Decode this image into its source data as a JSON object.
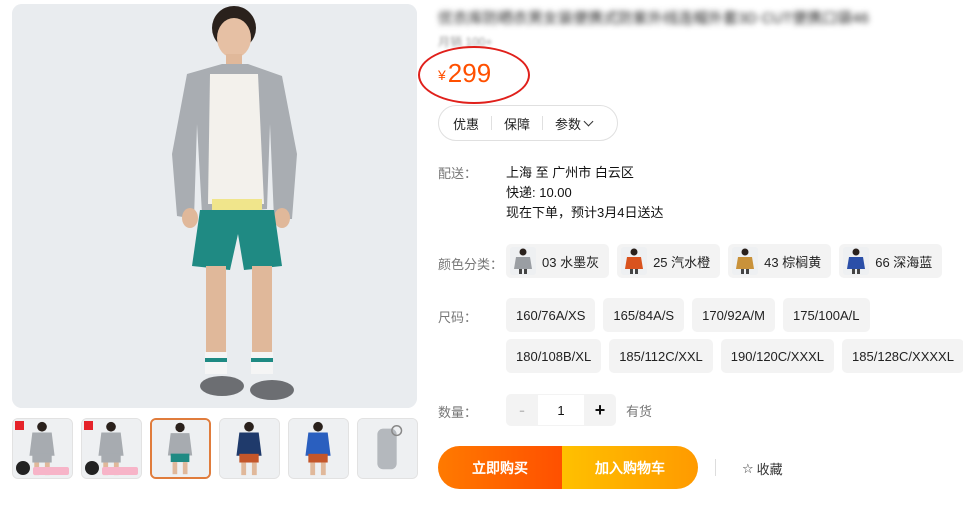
{
  "product": {
    "title": "优衣库防晒衣男女装便携式防紫外线连帽外套3D CUT便携口袋46",
    "sales": "月销 100+",
    "currency": "¥",
    "price": "299"
  },
  "tabs": [
    "优惠",
    "保障",
    "参数"
  ],
  "shipping": {
    "label": "配送：",
    "route": "上海 至 广州市 白云区",
    "express": "快递: 10.00",
    "eta": "现在下单，预计3月4日送达"
  },
  "colors": {
    "label": "颜色分类：",
    "options": [
      {
        "name": "03 水墨灰",
        "color": "#9a9ea3"
      },
      {
        "name": "25 汽水橙",
        "color": "#d9531e"
      },
      {
        "name": "43 棕榈黄",
        "color": "#c9923a"
      },
      {
        "name": "66 深海蓝",
        "color": "#2b4fa8"
      }
    ]
  },
  "sizes": {
    "label": "尺码：",
    "options": [
      "160/76A/XS",
      "165/84A/S",
      "170/92A/M",
      "175/100A/L",
      "180/108B/XL",
      "185/112C/XXL",
      "190/120C/XXXL",
      "185/128C/XXXXL"
    ]
  },
  "quantity": {
    "label": "数量：",
    "minus": "-",
    "value": "1",
    "plus": "+",
    "stock": "有货"
  },
  "actions": {
    "buy_now": "立即购买",
    "add_to_cart": "加入购物车",
    "favorite": "收藏",
    "favorite_icon": "star-icon"
  },
  "thumbnails": [
    {
      "name": "thumb-1",
      "jacket": "#a7abb0",
      "pants": "#a7abb0",
      "promo": true
    },
    {
      "name": "thumb-2",
      "jacket": "#a7abb0",
      "pants": "#a7abb0",
      "promo": true
    },
    {
      "name": "thumb-3",
      "jacket": "#a7abb0",
      "pants": "#1f8a83",
      "selected": true
    },
    {
      "name": "thumb-4",
      "jacket": "#1f3a6b",
      "pants": "#c4562a"
    },
    {
      "name": "thumb-5",
      "jacket": "#2a5fbf",
      "pants": "#c4562a"
    },
    {
      "name": "thumb-6",
      "jacket": "#b4b8bd",
      "pants": "none"
    }
  ]
}
